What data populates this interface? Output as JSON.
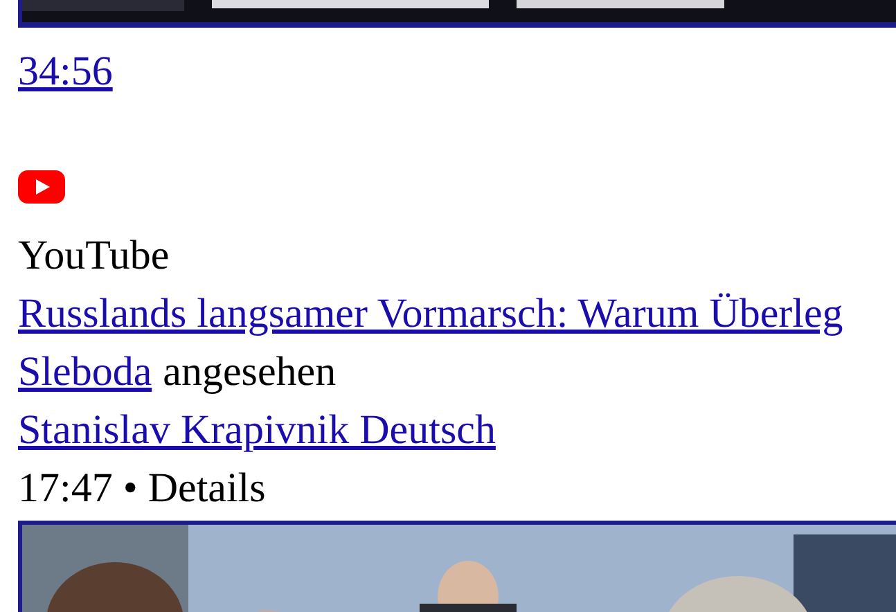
{
  "top_duration": "34:56",
  "source": "YouTube",
  "video_title": "Russlands langsamer Vormarsch: Warum Überleg",
  "viewed_by": {
    "name": "Sleboda",
    "suffix": "angesehen"
  },
  "channel": "Stanislav Krapivnik Deutsch",
  "meta": "17:47 • Details"
}
